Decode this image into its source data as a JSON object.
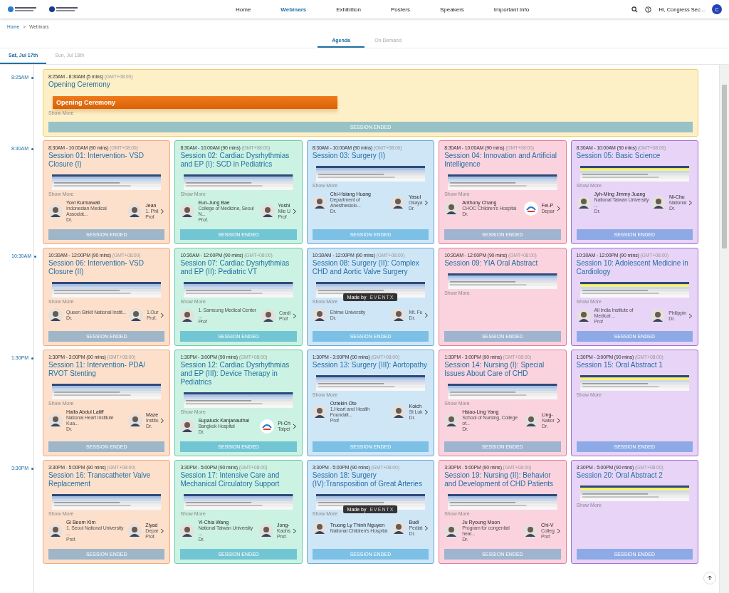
{
  "header": {
    "nav": [
      {
        "label": "Home",
        "selected": false
      },
      {
        "label": "Webinars",
        "selected": true
      },
      {
        "label": "Exhibition",
        "selected": false
      },
      {
        "label": "Posters",
        "selected": false
      },
      {
        "label": "Speakers",
        "selected": false
      },
      {
        "label": "Important Info",
        "selected": false
      }
    ],
    "greeting": "Hi, Congress Sec...",
    "avatar": "C"
  },
  "breadcrumb": {
    "items": [
      "Home",
      "Webinars"
    ],
    "separator": ">"
  },
  "view_tabs": [
    {
      "label": "Agenda",
      "selected": true
    },
    {
      "label": "On Demand",
      "selected": false
    }
  ],
  "date_tabs": [
    {
      "label": "Sat, Jul 17th",
      "selected": true
    },
    {
      "label": "Sun, Jul 18th",
      "selected": false
    }
  ],
  "opening": {
    "slot": "8:25AM",
    "time": "8:25AM - 8:30AM (5 mins)",
    "tz": "(GMT+08:00)",
    "title": "Opening Ceremony",
    "banner": "Opening Ceremony",
    "show_more": "Show More",
    "status": "SESSION ENDED",
    "color": "#fdefc6"
  },
  "slots": [
    {
      "time": "8:30AM",
      "sessions": [
        {
          "time": "8:30AM - 10:00AM (90 mins)",
          "tz": "(GMT+08:00)",
          "title": "Session 01: Intervention- VSD Closure (I)",
          "color": "#fde0cc",
          "show_more": "Show More",
          "status": "SESSION ENDED",
          "speakers": [
            {
              "kind": "person",
              "name": "Yovi Kurniawati",
              "affiliation": "Indonesian Medical Associat...",
              "title": "Dr."
            },
            {
              "kind": "person",
              "name": "Jean",
              "affiliation": "1. Phil",
              "title": "Prof"
            }
          ]
        },
        {
          "time": "8:30AM - 10:00AM (90 mins)",
          "tz": "(GMT+08:00)",
          "title": "Session 02: Cardiac Dysrhythmias and EP (I): SCD in Pediatrics",
          "color": "#cbf2e2",
          "show_more": "Show More",
          "status": "SESSION ENDED",
          "speakers": [
            {
              "kind": "person",
              "name": "Eun-Jung Bae",
              "affiliation": "College of Medicine, Seoul N...",
              "title": "Prof."
            },
            {
              "kind": "person",
              "name": "Yoshi",
              "affiliation": "Mie U",
              "title": "Prof"
            }
          ]
        },
        {
          "time": "8:30AM - 10:00AM (90 mins)",
          "tz": "(GMT+08:00)",
          "title": "Session 03: Surgery (I)",
          "color": "#cfe6f7",
          "show_more": "Show More",
          "status": "SESSION ENDED",
          "speakers": [
            {
              "kind": "person",
              "name": "Chi-Hsiang Huang",
              "affiliation": "Department of Anesthesiolo...",
              "title": "Dr."
            },
            {
              "kind": "person",
              "name": "Yasul",
              "affiliation": "Okaya",
              "title": "Dr."
            }
          ]
        },
        {
          "time": "8:30AM - 10:00AM (90 mins)",
          "tz": "(GMT+08:00)",
          "title": "Session 04: Innovation and Artificial Intelligence",
          "color": "#fbd3de",
          "show_more": "Show More",
          "status": "SESSION ENDED",
          "speakers": [
            {
              "kind": "person",
              "name": "Anthony Chang",
              "affiliation": "CHOC Children's Hospital",
              "title": "Dr."
            },
            {
              "kind": "logo",
              "name": "Fei-P",
              "affiliation": "Depar"
            }
          ]
        },
        {
          "time": "8:30AM - 10:00AM (90 mins)",
          "tz": "(GMT+08:00)",
          "title": "Session 05: Basic Science",
          "color": "#e8d4f7",
          "show_more": "Show More",
          "status": "SESSION ENDED",
          "speakers": [
            {
              "kind": "person",
              "name": "Jyh-Ming Jimmy Juang",
              "affiliation": "National Taiwan University ...",
              "title": "Dr."
            },
            {
              "kind": "person",
              "name": "Ni-Chu",
              "affiliation": "National",
              "title": "Dr."
            }
          ]
        }
      ]
    },
    {
      "time": "10:30AM",
      "sessions": [
        {
          "time": "10:30AM - 12:00PM (90 mins)",
          "tz": "(GMT+08:00)",
          "title": "Session 06: Intervention- VSD Closure (II)",
          "color": "#fde0cc",
          "show_more": "Show More",
          "status": "SESSION ENDED",
          "speakers": [
            {
              "kind": "person",
              "affiliation": "Queen Sirikit National Instit...",
              "title": "Dr."
            },
            {
              "kind": "person",
              "affiliation": "1.Our",
              "title": "Prof."
            }
          ]
        },
        {
          "time": "10:30AM - 12:00PM (90 mins)",
          "tz": "(GMT+08:00)",
          "title": "Session 07: Cardiac Dysrhythmias and EP (II): Pediatric VT",
          "color": "#cbf2e2",
          "show_more": "Show More",
          "status": "SESSION ENDED",
          "speakers": [
            {
              "kind": "person",
              "affiliation": "1. Samsung Medical Center ...",
              "title": "Prof"
            },
            {
              "kind": "person",
              "affiliation": "Cardi",
              "title": "Prof"
            }
          ]
        },
        {
          "time": "10:30AM - 12:00PM (90 mins)",
          "tz": "(GMT+08:00)",
          "title": "Session 08: Surgery (II): Complex CHD and Aortic Valve Surgery",
          "color": "#cfe6f7",
          "show_more": "Show More",
          "status": "SESSION ENDED",
          "made_by": {
            "label": "Made by",
            "brand": "EVENTX"
          },
          "speakers": [
            {
              "kind": "person",
              "affiliation": "Ehime University",
              "title": "Dr."
            },
            {
              "kind": "person",
              "affiliation": "Mt. Fu",
              "title": "Dr."
            }
          ]
        },
        {
          "time": "10:30AM - 12:00PM (90 mins)",
          "tz": "(GMT+08:00)",
          "title": "Session 09: YIA Oral Abstract",
          "color": "#fbd3de",
          "show_more": "Show More",
          "status": "SESSION ENDED"
        },
        {
          "time": "10:30AM - 12:00PM (90 mins)",
          "tz": "(GMT+08:00)",
          "title": "Session 10: Adolescent Medicine in Cardiology",
          "color": "#e8d4f7",
          "show_more": "Show More",
          "status": "SESSION ENDED",
          "speakers": [
            {
              "kind": "person",
              "affiliation": "All India Institute of Medical ...",
              "title": "Prof"
            },
            {
              "kind": "person",
              "affiliation": "Philippin",
              "title": "Dr."
            }
          ]
        }
      ]
    },
    {
      "time": "1:30PM",
      "sessions": [
        {
          "time": "1:30PM - 3:00PM (90 mins)",
          "tz": "(GMT+08:00)",
          "title": "Session 11: Intervention- PDA/ RVOT Stenting",
          "color": "#fde0cc",
          "show_more": "Show More",
          "status": "SESSION ENDED",
          "speakers": [
            {
              "kind": "person",
              "name": "Haifa Abdul Latiff",
              "affiliation": "National Heart Institute Kua...",
              "title": "Dr."
            },
            {
              "kind": "person",
              "name": "Maze",
              "affiliation": "Institu",
              "title": "Dr."
            }
          ]
        },
        {
          "time": "1:30PM - 3:00PM (90 mins)",
          "tz": "(GMT+08:00)",
          "title": "Session 12: Cardiac Dysrhythmias and EP (III): Device Therapy in Pediatrics",
          "color": "#cbf2e2",
          "show_more": "Show More",
          "status": "SESSION ENDED",
          "speakers": [
            {
              "kind": "person",
              "name": "Supaluck Kanjanauthai",
              "affiliation": "Bangkok Hospital",
              "title": "Dr."
            },
            {
              "kind": "logo",
              "name": "Pi-Ch",
              "affiliation": "Taipei"
            }
          ]
        },
        {
          "time": "1:30PM - 3:00PM (90 mins)",
          "tz": "(GMT+08:00)",
          "title": "Session 13: Surgery (III): Aortopathy",
          "color": "#cfe6f7",
          "show_more": "Show More",
          "status": "SESSION ENDED",
          "speakers": [
            {
              "kind": "person",
              "name": "Oztekin Oto",
              "affiliation": "1.Heart and Health Foundati...",
              "title": "Prof"
            },
            {
              "kind": "person",
              "name": "Koich",
              "affiliation": "St Luk",
              "title": "Dr."
            }
          ]
        },
        {
          "time": "1:30PM - 3:00PM (90 mins)",
          "tz": "(GMT+08:00)",
          "title": "Session 14: Nursing (I): Special Issues About Care of CHD",
          "color": "#fbd3de",
          "show_more": "Show More",
          "status": "SESSION ENDED",
          "speakers": [
            {
              "kind": "person",
              "name": "Hsiao-Ling Yang",
              "affiliation": "School of Nursing, College of...",
              "title": "Dr."
            },
            {
              "kind": "person",
              "name": "Ling-",
              "affiliation": "Natior",
              "title": "Dr."
            }
          ]
        },
        {
          "time": "1:30PM - 3:00PM (90 mins)",
          "tz": "(GMT+08:00)",
          "title": "Session 15: Oral Abstract 1",
          "color": "#e8d4f7",
          "show_more": "Show More",
          "status": "SESSION ENDED"
        }
      ]
    },
    {
      "time": "3:30PM",
      "sessions": [
        {
          "time": "3:30PM - 5:00PM (90 mins)",
          "tz": "(GMT+08:00)",
          "title": "Session 16: Transcatheter Valve Replacement",
          "color": "#fde0cc",
          "show_more": "Show More",
          "status": "SESSION ENDED",
          "speakers": [
            {
              "kind": "person",
              "name": "Gi Beom Kim",
              "affiliation": "1. Seoul National University ...",
              "title": "Prof."
            },
            {
              "kind": "person",
              "name": "Ziyad",
              "affiliation": "Depar",
              "title": "Prof."
            }
          ]
        },
        {
          "time": "3:30PM - 5:00PM (90 mins)",
          "tz": "(GMT+08:00)",
          "title": "Session 17: Intensive Care and Mechanical Circulatory Support",
          "color": "#cbf2e2",
          "show_more": "Show More",
          "status": "SESSION ENDED",
          "speakers": [
            {
              "kind": "person",
              "name": "Yi-Chia Wang",
              "affiliation": "National Taiwan University ...",
              "title": "Dr."
            },
            {
              "kind": "person",
              "name": "Jong-",
              "affiliation": "Kaohs",
              "title": "Prof."
            }
          ]
        },
        {
          "time": "3:30PM - 5:00PM (90 mins)",
          "tz": "(GMT+08:00)",
          "title": "Session 18: Surgery (IV):Transposition of Great Arteries",
          "color": "#cfe6f7",
          "show_more": "Show More",
          "status": "SESSION ENDED",
          "made_by": {
            "label": "Made by",
            "brand": "EVENTX"
          },
          "speakers": [
            {
              "kind": "person",
              "name": "Truong Ly Thinh Nguyen",
              "affiliation": "National Children's Hospital"
            },
            {
              "kind": "person",
              "name": "Budi",
              "affiliation": "Pediat",
              "title": "Dr."
            }
          ]
        },
        {
          "time": "3:30PM - 5:00PM (90 mins)",
          "tz": "(GMT+08:00)",
          "title": "Session 19: Nursing (II): Behavior and Development of CHD Patients",
          "color": "#fbd3de",
          "show_more": "Show More",
          "status": "SESSION ENDED",
          "speakers": [
            {
              "kind": "person",
              "name": "Ju Ryoung Moon",
              "affiliation": "Program for congenital hear...",
              "title": "Dr."
            },
            {
              "kind": "person",
              "name": "Chi-V",
              "affiliation": "Colleg",
              "title": "Prof"
            }
          ]
        },
        {
          "time": "3:30PM - 5:00PM (90 mins)",
          "tz": "(GMT+08:00)",
          "title": "Session 20: Oral Abstract 2",
          "color": "#e8d4f7",
          "show_more": "Show More",
          "status": "SESSION ENDED"
        }
      ]
    }
  ]
}
